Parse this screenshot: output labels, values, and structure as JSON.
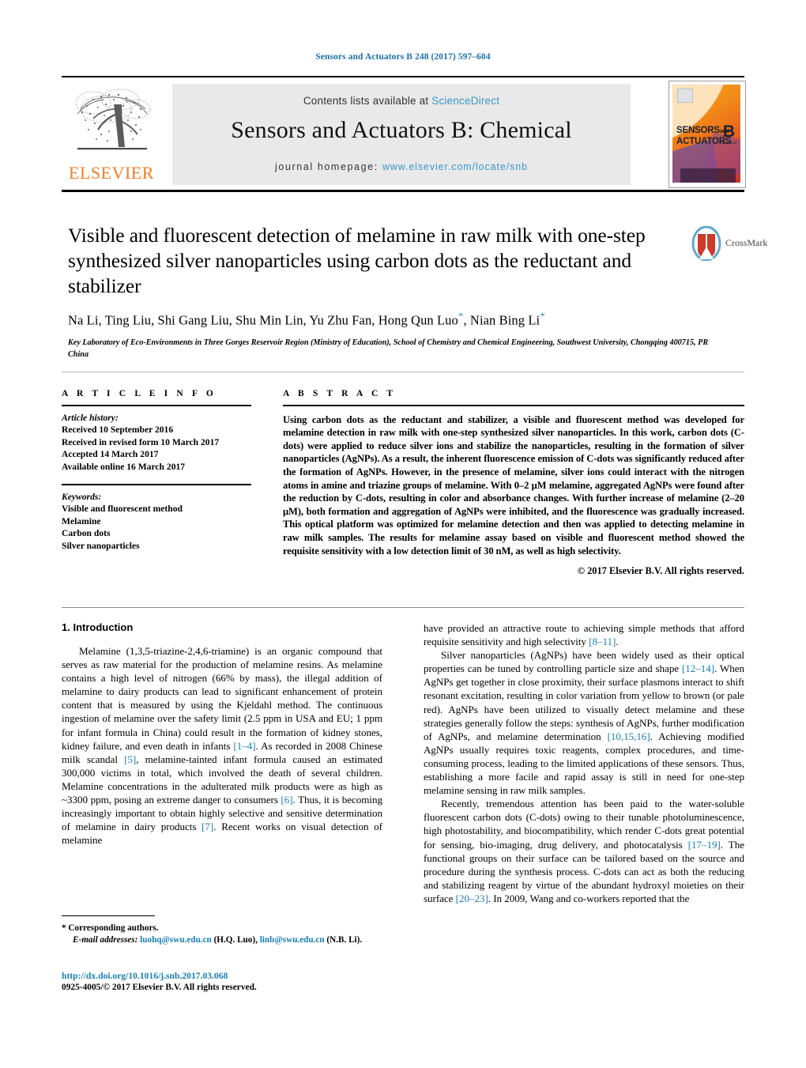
{
  "running_head": "Sensors and Actuators B 248 (2017) 597–604",
  "masthead": {
    "publisher_name": "ELSEVIER",
    "contents_prefix": "Contents lists available at ",
    "sciencedirect": "ScienceDirect",
    "journal_title": "Sensors and Actuators B: Chemical",
    "homepage_label": "journal homepage:",
    "homepage_url": "www.elsevier.com/locate/snb",
    "cover": {
      "line1": "SENSORS",
      "line1_suffix": "and",
      "line2": "ACTUATORS",
      "series": "B",
      "series_sub": "Chemical"
    }
  },
  "article": {
    "title": "Visible and fluorescent detection of melamine in raw milk with one-step synthesized silver nanoparticles using carbon dots as the reductant and stabilizer",
    "authors": "Na Li, Ting Liu, Shi Gang Liu, Shu Min Lin, Yu Zhu Fan, Hong Qun Luo",
    "authors_tail": ", Nian Bing Li",
    "affiliation": "Key Laboratory of Eco-Environments in Three Gorges Reservoir Region (Ministry of Education), School of Chemistry and Chemical Engineering, Southwest University, Chongqing 400715, PR China",
    "crossmark_label": "CrossMark"
  },
  "article_info": {
    "heading": "A R T I C L E   I N F O",
    "history_label": "Article history:",
    "history": [
      "Received 10 September 2016",
      "Received in revised form 10 March 2017",
      "Accepted 14 March 2017",
      "Available online 16 March 2017"
    ],
    "keywords_label": "Keywords:",
    "keywords": [
      "Visible and fluorescent method",
      "Melamine",
      "Carbon dots",
      "Silver nanoparticles"
    ]
  },
  "abstract": {
    "heading": "A B S T R A C T",
    "text": "Using carbon dots as the reductant and stabilizer, a visible and fluorescent method was developed for melamine detection in raw milk with one-step synthesized silver nanoparticles. In this work, carbon dots (C-dots) were applied to reduce silver ions and stabilize the nanoparticles, resulting in the formation of silver nanoparticles (AgNPs). As a result, the inherent fluorescence emission of C-dots was significantly reduced after the formation of AgNPs. However, in the presence of melamine, silver ions could interact with the nitrogen atoms in amine and triazine groups of melamine. With 0–2 μM melamine, aggregated AgNPs were found after the reduction by C-dots, resulting in color and absorbance changes. With further increase of melamine (2–20 μM), both formation and aggregation of AgNPs were inhibited, and the fluorescence was gradually increased. This optical platform was optimized for melamine detection and then was applied to detecting melamine in raw milk samples. The results for melamine assay based on visible and fluorescent method showed the requisite sensitivity with a low detection limit of 30 nM, as well as high selectivity.",
    "copyright": "© 2017 Elsevier B.V. All rights reserved."
  },
  "body": {
    "section_number_title": "1.  Introduction",
    "left_paragraphs": [
      "Melamine (1,3,5-triazine-2,4,6-triamine) is an organic compound that serves as raw material for the production of melamine resins. As melamine contains a high level of nitrogen (66% by mass), the illegal addition of melamine to dairy products can lead to significant enhancement of protein content that is measured by using the Kjeldahl method. The continuous ingestion of melamine over the safety limit (2.5 ppm in USA and EU; 1 ppm for infant formula in China) could result in the formation of kidney stones, kidney failure, and even death in infants [1–4]. As recorded in 2008 Chinese milk scandal [5], melamine-tainted infant formula caused an estimated 300,000 victims in total, which involved the death of several children. Melamine concentrations in the adulterated milk products were as high as ~3300 ppm, posing an extreme danger to consumers [6]. Thus, it is becoming increasingly important to obtain highly selective and sensitive determination of melamine in dairy products [7]. Recent works on visual detection of melamine"
    ],
    "right_paragraphs": [
      "have provided an attractive route to achieving simple methods that afford requisite sensitivity and high selectivity [8–11].",
      "Silver nanoparticles (AgNPs) have been widely used as their optical properties can be tuned by controlling particle size and shape [12–14]. When AgNPs get together in close proximity, their surface plasmons interact to shift resonant excitation, resulting in color variation from yellow to brown (or pale red). AgNPs have been utilized to visually detect melamine and these strategies generally follow the steps: synthesis of AgNPs, further modification of AgNPs, and melamine determination [10,15,16]. Achieving modified AgNPs usually requires toxic reagents, complex procedures, and time-consuming process, leading to the limited applications of these sensors. Thus, establishing a more facile and rapid assay is still in need for one-step melamine sensing in raw milk samples.",
      "Recently, tremendous attention has been paid to the water-soluble fluorescent carbon dots (C-dots) owing to their tunable photoluminescence, high photostability, and biocompatibility, which render C-dots great potential for sensing, bio-imaging, drug delivery, and photocatalysis [17–19]. The functional groups on their surface can be tailored based on the source and procedure during the synthesis process. C-dots can act as both the reducing and stabilizing reagent by virtue of the abundant hydroxyl moieties on their surface [20–23]. In 2009, Wang and co-workers reported that the"
    ]
  },
  "footnote": {
    "corresponding": "* Corresponding authors.",
    "email_label": "E-mail addresses:",
    "email1": "luohq@swu.edu.cn",
    "email1_owner": "(H.Q. Luo),",
    "email2": "linb@swu.edu.cn",
    "email2_owner": "(N.B. Li)."
  },
  "doi": {
    "url": "http://dx.doi.org/10.1016/j.snb.2017.03.068",
    "issn_line": "0925-4005/© 2017 Elsevier B.V. All rights reserved."
  },
  "colors": {
    "link_blue": "#1a7eb5",
    "sciencedirect_blue": "#3a95c8",
    "elsevier_orange": "#f57c20",
    "band_grey": "#e9e9e9"
  }
}
